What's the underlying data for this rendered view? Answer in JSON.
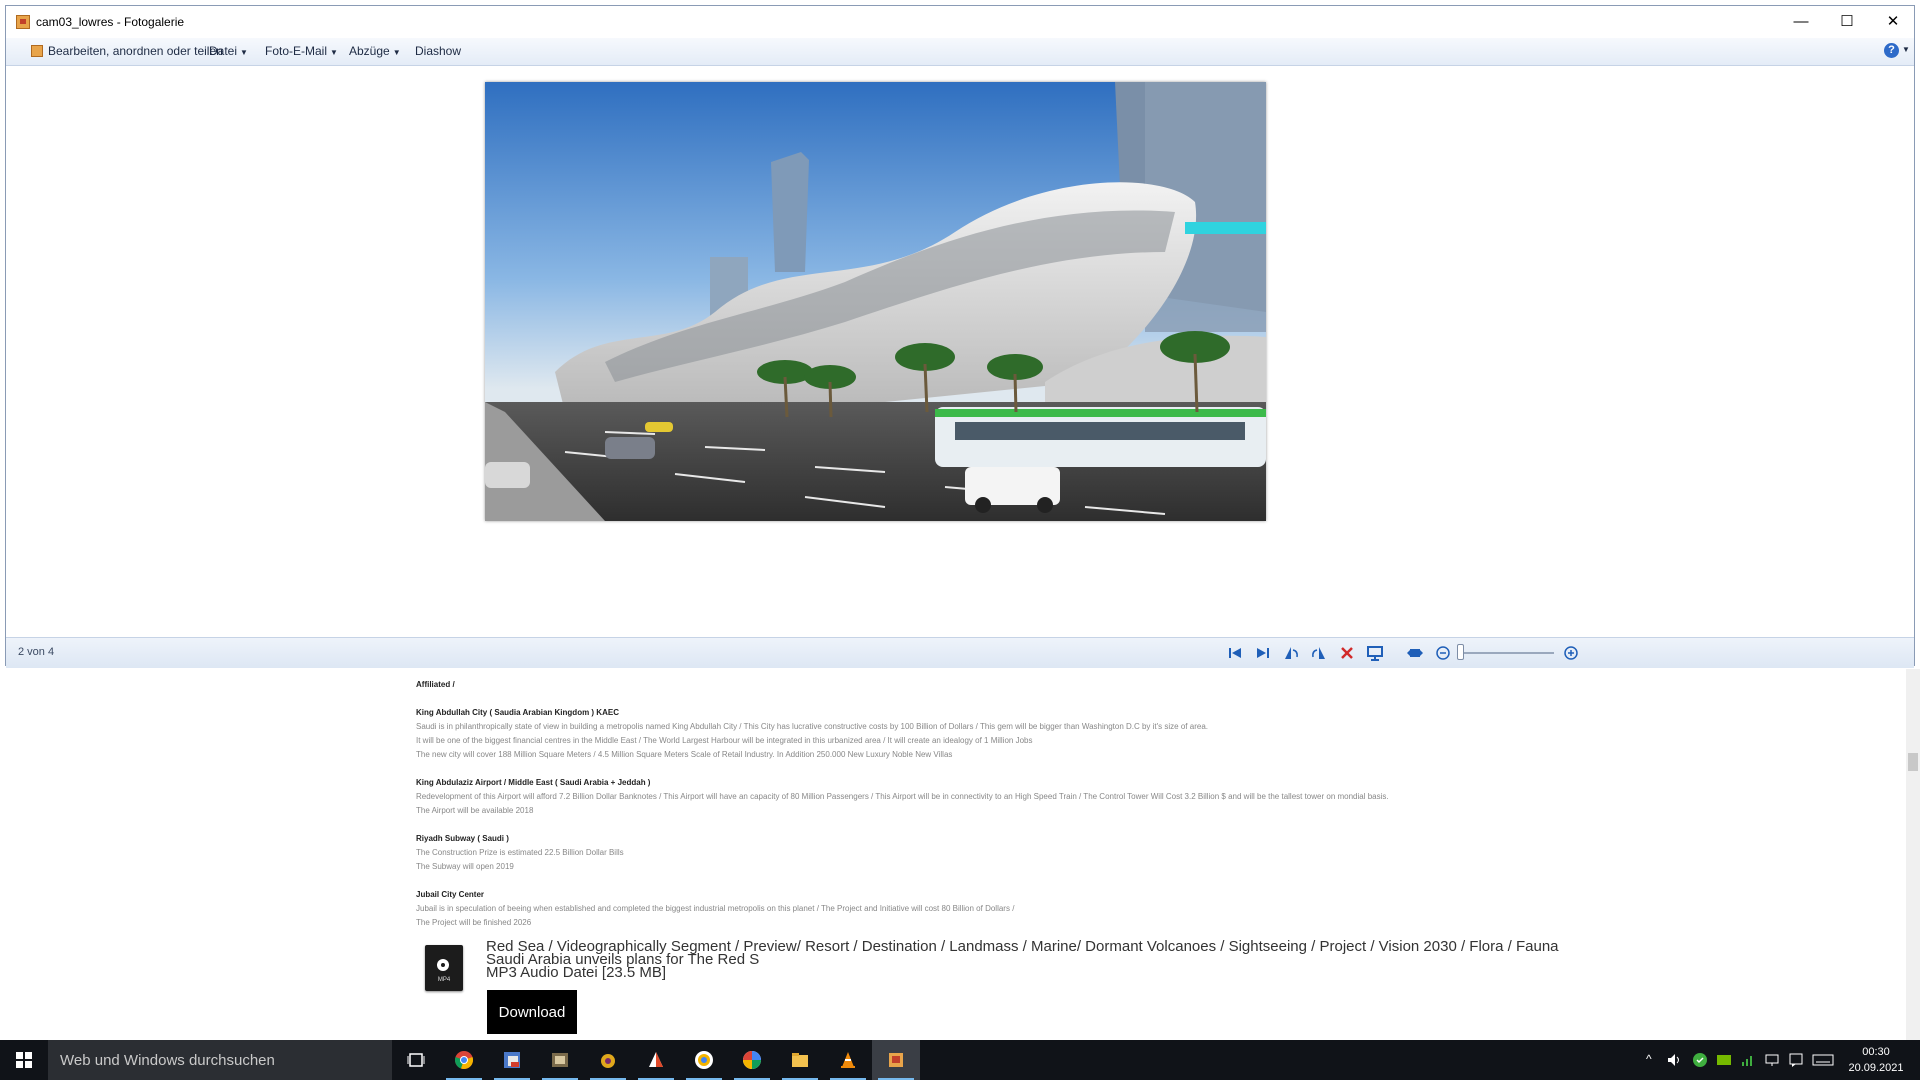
{
  "window": {
    "title": "cam03_lowres - Fotogalerie",
    "min_symbol": "—",
    "max_symbol": "☐",
    "close_symbol": "✕"
  },
  "menu": {
    "edit": "Bearbeiten, anordnen oder teilen",
    "file": "Datei",
    "email": "Foto-E-Mail",
    "prints": "Abzüge",
    "slideshow": "Diashow",
    "help_symbol": "?"
  },
  "status": {
    "counter": "2 von 4"
  },
  "toolbar_icons": [
    "previous-icon",
    "next-icon",
    "rotate-left-icon",
    "rotate-right-icon",
    "delete-icon",
    "slideshow-icon",
    "fit-window-icon",
    "zoom-out-icon",
    "zoom-in-icon"
  ],
  "zoom_level": 0.02,
  "article": {
    "affiliated": "Affiliated /",
    "sections": [
      {
        "heading": "King Abdullah City ( Saudia Arabian Kingdom ) KAEC",
        "lines": [
          "Saudi is in philanthropically state of view in building a metropolis named King Abdullah City / This City has lucrative constructive costs by 100 Billion of Dollars / This gem will be bigger than Washington D.C by it's size of area.",
          "It will be one of the biggest financial centres in the Middle East / The World Largest Harbour will be integrated in this urbanized area / It will create an idealogy of 1 Million Jobs",
          "The new city will cover 188 Million Square Meters / 4.5 Million Square Meters Scale of Retail Industry. In Addition 250.000 New Luxury Noble New Villas"
        ]
      },
      {
        "heading": "King Abdulaziz Airport / Middle East ( Saudi Arabia + Jeddah )",
        "lines": [
          "Redevelopment of this Airport will afford 7.2 Billion Dollar Banknotes / This Airport will have an capacity of 80 Million Passengers / This Airport will be in connectivity to an High Speed Train / The Control Tower Will Cost 3.2 Billion $ and will be the tallest tower on mondial basis.",
          "The Airport will be available 2018"
        ]
      },
      {
        "heading": "Riyadh Subway ( Saudi )",
        "lines": [
          "The Construction Prize is estimated 22.5 Billion Dollar Bills",
          "The Subway will open 2019"
        ]
      },
      {
        "heading": "Jubail City Center",
        "lines": [
          "Jubail is in speculation of beeing when established and completed the biggest industrial metropolis on this planet / The Project and Initiative will cost 80 Billion of Dollars /",
          "The Project will be finished 2026"
        ]
      }
    ]
  },
  "media": {
    "title": "Red Sea / Videographically Segment / Preview/ Resort / Destination / Landmass / Marine/ Dormant Volcanoes / Sightseeing / Project / Vision 2030 / Flora / Fauna",
    "subtitle": "Saudi Arabia unveils plans for The Red S",
    "info": "MP3 Audio Datei [23.5 MB]",
    "ext": "MP4",
    "download_label": "Download"
  },
  "taskbar": {
    "search_placeholder": "Web und Windows durchsuchen",
    "apps": [
      "task-view-icon",
      "chrome-icon",
      "pdf-viewer-icon",
      "photo-app-icon",
      "media-app-icon",
      "office-icon",
      "chrome-alt-icon",
      "photos-icon",
      "file-explorer-icon",
      "vlc-icon",
      "photo-gallery-icon"
    ],
    "tray_chevron": "^",
    "time": "00:30",
    "date": "20.09.2021"
  }
}
